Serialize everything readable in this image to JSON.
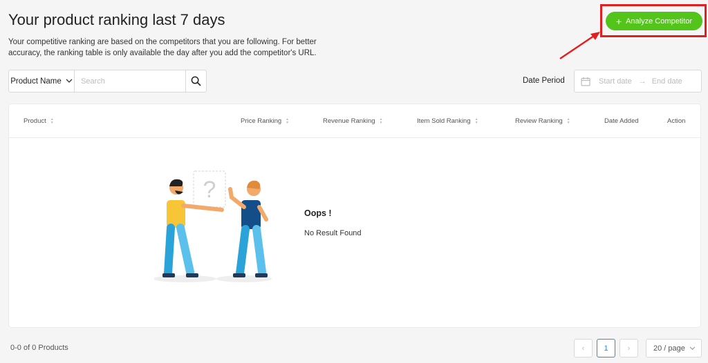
{
  "header": {
    "title": "Your product ranking last 7 days",
    "description": "Your competitive ranking are based on the competitors that you are following. For better accuracy, the ranking table is only available the day after you add the competitor's URL."
  },
  "analyze_button": {
    "label": "Analyze Competitor",
    "icon": "plus-icon"
  },
  "filter": {
    "field_label": "Product Name",
    "search_placeholder": "Search",
    "search_icon": "search-icon"
  },
  "date_filter": {
    "label": "Date Period",
    "start_placeholder": "Start date",
    "end_placeholder": "End date",
    "icon": "calendar-icon"
  },
  "table": {
    "columns": [
      {
        "label": "Product",
        "sortable": true
      },
      {
        "label": "Price Ranking",
        "sortable": true
      },
      {
        "label": "Revenue Ranking",
        "sortable": true
      },
      {
        "label": "Item Sold Ranking",
        "sortable": true
      },
      {
        "label": "Review Ranking",
        "sortable": true
      },
      {
        "label": "Date Added",
        "sortable": false
      },
      {
        "label": "Action",
        "sortable": false
      }
    ],
    "empty": {
      "title": "Oops !",
      "message": "No Result Found"
    }
  },
  "pagination": {
    "summary": "0-0 of 0 Products",
    "current_page": "1",
    "page_size": "20 / page"
  },
  "colors": {
    "primary_green": "#52c41a",
    "highlight_red": "#e02020",
    "active_blue": "#1890ff"
  }
}
